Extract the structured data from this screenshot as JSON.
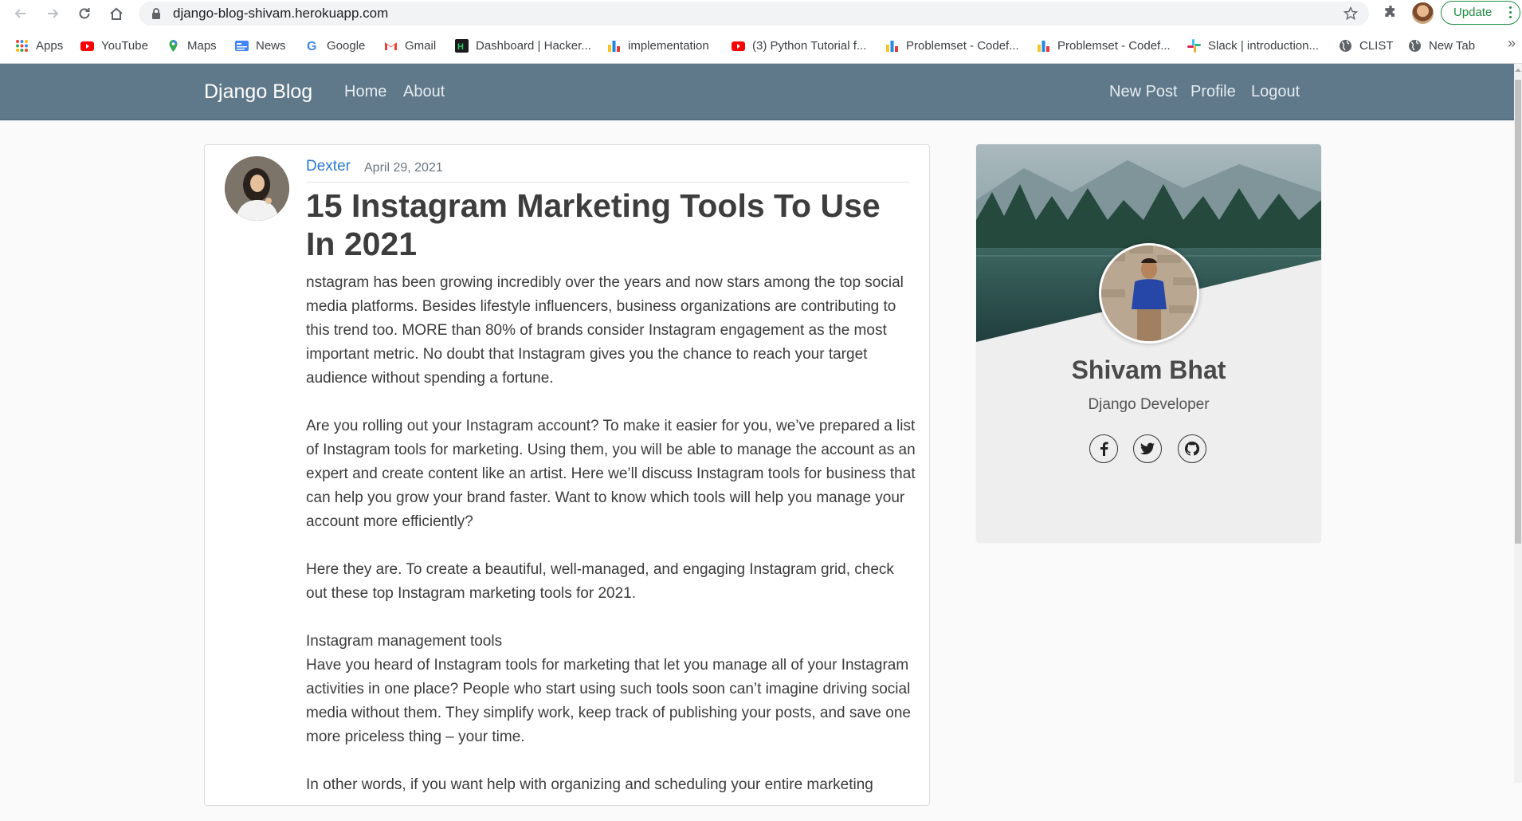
{
  "browser": {
    "url": "django-blog-shivam.herokuapp.com",
    "update_label": "Update",
    "bookmarks": [
      {
        "label": "Apps",
        "icon": "apps-grid-icon"
      },
      {
        "label": "YouTube",
        "icon": "youtube-icon"
      },
      {
        "label": "Maps",
        "icon": "maps-pin-icon"
      },
      {
        "label": "News",
        "icon": "google-news-icon"
      },
      {
        "label": "Google",
        "icon": "google-icon"
      },
      {
        "label": "Gmail",
        "icon": "gmail-icon"
      },
      {
        "label": "Dashboard | Hacker...",
        "icon": "hackerrank-icon"
      },
      {
        "label": "implementation",
        "icon": "codeforces-icon"
      },
      {
        "label": "(3) Python Tutorial f...",
        "icon": "youtube-icon"
      },
      {
        "label": "Problemset - Codef...",
        "icon": "codeforces-icon"
      },
      {
        "label": "Problemset - Codef...",
        "icon": "codeforces-icon"
      },
      {
        "label": "Slack | introduction...",
        "icon": "slack-icon"
      },
      {
        "label": "CLIST",
        "icon": "globe-icon"
      },
      {
        "label": "New Tab",
        "icon": "globe-icon"
      }
    ]
  },
  "site": {
    "brand": "Django Blog",
    "nav_left": [
      "Home",
      "About"
    ],
    "nav_right": [
      "New Post",
      "Profile",
      "Logout"
    ]
  },
  "post": {
    "author": "Dexter",
    "date": "April 29, 2021",
    "title": "15 Instagram Marketing Tools To Use In 2021",
    "paragraphs": [
      "nstagram has been growing incredibly over the years and now stars among the top social media platforms. Besides lifestyle influencers, business organizations are contributing to this trend too. MORE than 80% of brands consider Instagram engagement as the most important metric. No doubt that Instagram gives you the chance to reach your target audience without spending a fortune.",
      "Are you rolling out your Instagram account? To make it easier for you, we’ve prepared a list of Instagram tools for marketing. Using them, you will be able to manage the account as an expert and create content like an artist. Here we’ll discuss Instagram tools for business that can help you grow your brand faster. Want to know which tools will help you manage your account more efficiently?",
      "Here they are. To create a beautiful, well-managed, and engaging Instagram grid, check out these top Instagram marketing tools for 2021.",
      "Instagram management tools",
      "Have you heard of Instagram tools for marketing that let you manage all of your Instagram activities in one place? People who start using such tools soon can’t imagine driving social media without them. They simplify work, keep track of publishing your posts, and save one more priceless thing – your time.",
      "In other words, if you want help with organizing and scheduling your entire marketing"
    ]
  },
  "profile_card": {
    "name": "Shivam Bhat",
    "role": "Django Developer",
    "socials": [
      "facebook-icon",
      "twitter-icon",
      "github-icon"
    ]
  },
  "colors": {
    "navbar": "#5f788a",
    "link": "#2b7ad6",
    "update_green": "#1e8e3e"
  }
}
